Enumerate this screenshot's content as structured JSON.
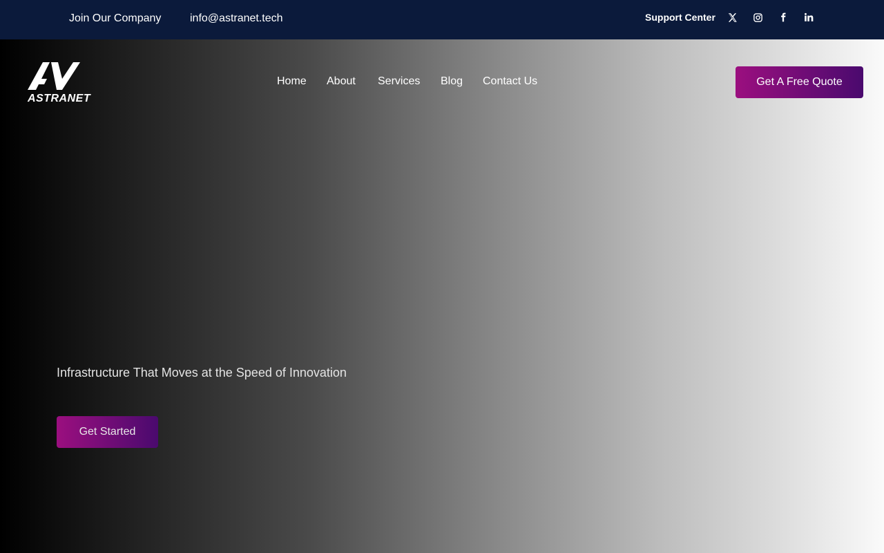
{
  "topbar": {
    "join_label": "Join Our Company",
    "email": "info@astranet.tech",
    "support_label": "Support Center",
    "socials": [
      "x-icon",
      "instagram-icon",
      "facebook-icon",
      "linkedin-icon"
    ]
  },
  "brand": {
    "logo_name": "ASTRANET"
  },
  "nav": {
    "items": [
      "Home",
      "About",
      "Services",
      "Blog",
      "Contact Us"
    ]
  },
  "header": {
    "quote_label": "Get A Free Quote"
  },
  "hero": {
    "tagline": "Infrastructure That Moves at the Speed of Innovation",
    "cta_label": "Get Started"
  },
  "colors": {
    "topbar_bg": "#0b1a3b",
    "button_gradient_start": "#9b0f7f",
    "button_gradient_end": "#4a0a6e"
  }
}
